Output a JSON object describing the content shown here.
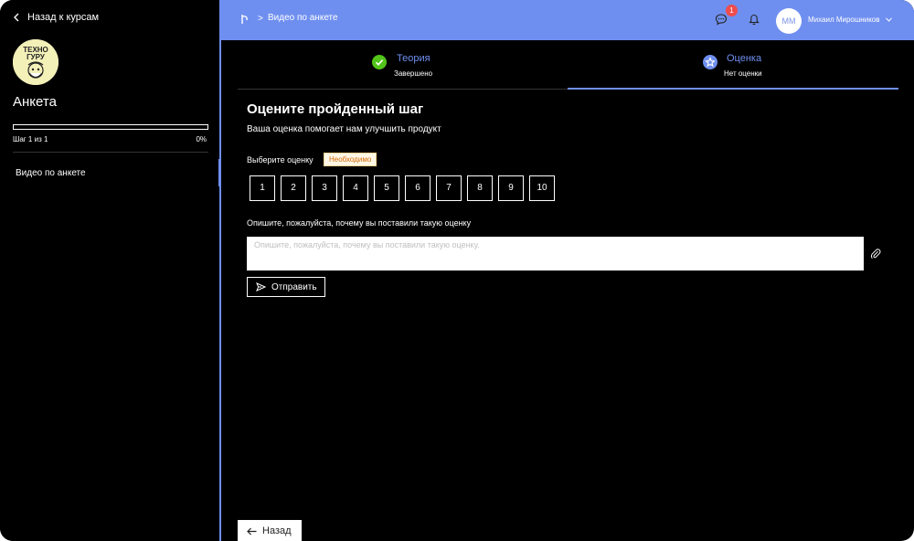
{
  "sidebar": {
    "back_label": "Назад к курсам",
    "logo_text": [
      "ТЕХНО",
      "ГУРУ"
    ],
    "course_title": "Анкета",
    "progress_fraction": 0.0,
    "step_text": "Шаг 1 из 1",
    "progress_percent": "0%",
    "items": [
      {
        "label": "Видео по анкете",
        "active": true
      }
    ]
  },
  "header": {
    "breadcrumb_separator": ">",
    "breadcrumb": "Видео по анкете",
    "chat_badge_count": "1",
    "avatar_initials": "ММ",
    "user_name": "Михаил Мирошников",
    "accent_color": "#6f8ff0",
    "badge_color": "#ee4d4d"
  },
  "tabs": [
    {
      "title": "Теория",
      "subtitle": "Завершено",
      "icon": "check-circle-icon",
      "icon_color": "#52c41a"
    },
    {
      "title": "Оценка",
      "subtitle": "Нет оценки",
      "icon": "star-icon",
      "icon_color": "#6f8ff0",
      "active": true
    }
  ],
  "main": {
    "title": "Оцените пройденный шаг",
    "subtitle": "Ваша оценка помогает нам улучшить продукт",
    "rating_label": "Выберите оценку",
    "required_badge": "Необходимо",
    "rating_options": [
      "1",
      "2",
      "3",
      "4",
      "5",
      "6",
      "7",
      "8",
      "9",
      "10"
    ],
    "comment_label": "Опишите, пожалуйста, почему вы поставили такую оценку",
    "comment_placeholder": "Опишите, пожалуйста, почему вы поставили такую оценку.",
    "comment_value": "",
    "send_label": "Отправить",
    "back_label": "Назад"
  }
}
